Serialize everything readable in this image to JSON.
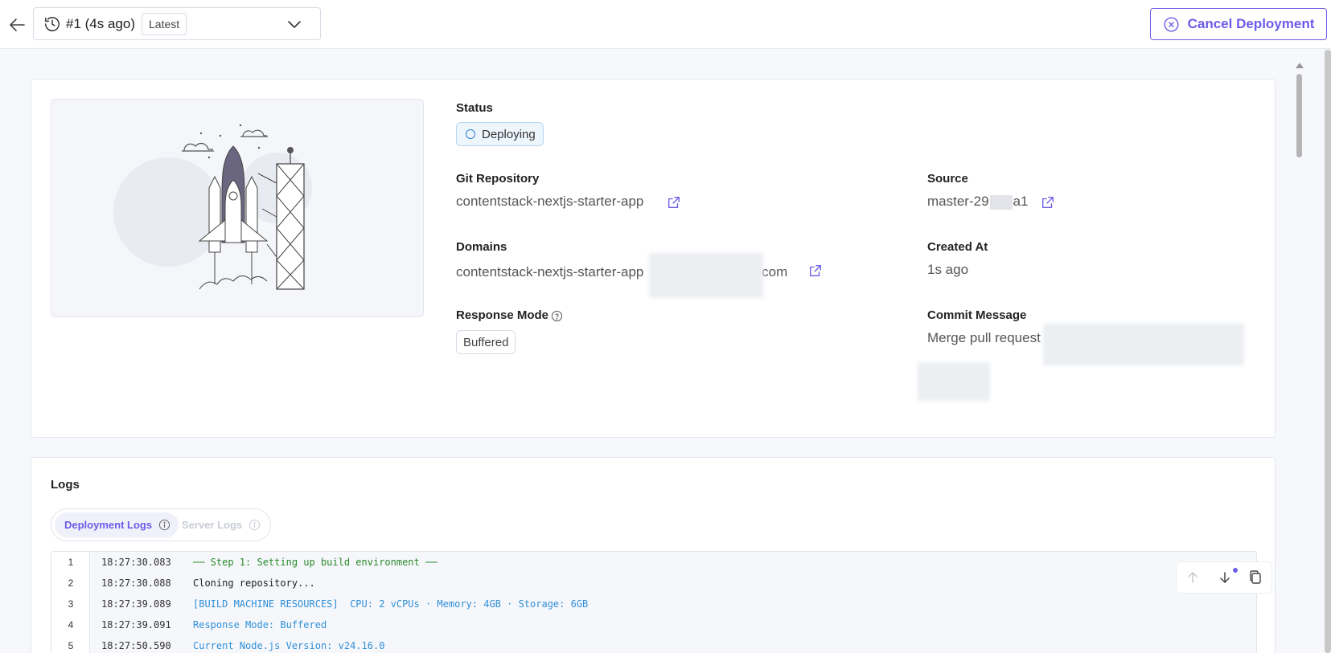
{
  "header": {
    "deployment_label": "#1 (4s ago)",
    "latest_badge": "Latest",
    "cancel_label": "Cancel Deployment"
  },
  "details": {
    "status_label": "Status",
    "status_value": "Deploying",
    "git_repo_label": "Git Repository",
    "git_repo_value": "contentstack-nextjs-starter-app",
    "source_label": "Source",
    "source_prefix": "master-29",
    "source_suffix": "a1",
    "domains_label": "Domains",
    "domain_prefix": "contentstack-nextjs-starter-app",
    "domain_suffix": ".com",
    "created_at_label": "Created At",
    "created_at_value": "1s ago",
    "response_mode_label": "Response Mode",
    "response_mode_value": "Buffered",
    "commit_message_label": "Commit Message",
    "commit_message_value": "Merge pull request"
  },
  "logs": {
    "title": "Logs",
    "tabs": [
      {
        "label": "Deployment Logs",
        "active": true
      },
      {
        "label": "Server Logs",
        "active": false
      }
    ],
    "lines": [
      {
        "num": "1",
        "ts": "18:27:30.083",
        "msg": "── Step 1: Setting up build environment ──",
        "color": "#2a8a2a"
      },
      {
        "num": "2",
        "ts": "18:27:30.088",
        "msg": "Cloning repository...",
        "color": "#222222"
      },
      {
        "num": "3",
        "ts": "18:27:39.089",
        "msg": "[BUILD MACHINE RESOURCES]  CPU: 2 vCPUs · Memory: 4GB · Storage: 6GB",
        "color": "#2f8fd8"
      },
      {
        "num": "4",
        "ts": "18:27:39.091",
        "msg": "Response Mode: Buffered",
        "color": "#2f8fd8"
      },
      {
        "num": "5",
        "ts": "18:27:50.590",
        "msg": "Current Node.js Version: v24.16.0",
        "color": "#2f8fd8"
      }
    ]
  },
  "colors": {
    "accent": "#6c5ce7",
    "status_blue": "#2f80d1",
    "log_green": "#2a8a2a",
    "log_blue": "#2f8fd8"
  },
  "icons": [
    "back-arrow-icon",
    "history-icon",
    "chevron-down-icon",
    "cancel-circle-icon",
    "external-link-icon",
    "help-circle-icon",
    "info-icon",
    "arrow-up-icon",
    "arrow-down-icon",
    "copy-icon"
  ]
}
